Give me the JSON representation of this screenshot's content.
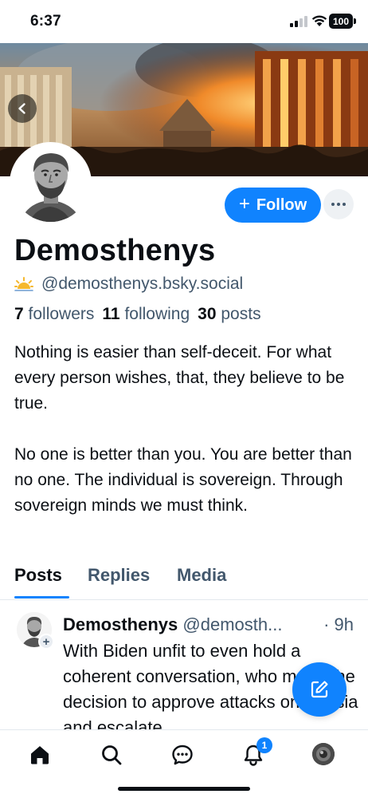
{
  "status_bar": {
    "time": "6:37",
    "battery": "100"
  },
  "banner": {
    "description_icon": "burning-city-painting"
  },
  "profile": {
    "display_name": "Demosthenys",
    "handle": "@demosthenys.bsky.social",
    "stats": [
      {
        "value": "7",
        "label": "followers"
      },
      {
        "value": "11",
        "label": "following"
      },
      {
        "value": "30",
        "label": "posts"
      }
    ],
    "bio": [
      "Nothing is easier than self-deceit. For what every person wishes, that, they believe to be true.",
      "No one is better than you. You are better than no one. The individual is sovereign. Through sovereign minds we must think."
    ]
  },
  "actions": {
    "follow_plus": "+",
    "follow_label": "Follow"
  },
  "tabs": [
    {
      "label": "Posts",
      "active": true
    },
    {
      "label": "Replies",
      "active": false
    },
    {
      "label": "Media",
      "active": false
    }
  ],
  "post": {
    "author": "Demosthenys",
    "handle": "@demosth...",
    "time": "· 9h",
    "text": "With Biden unfit to even hold a coherent conversation, who made the decision to approve attacks on Russia and escalate"
  },
  "bottom_nav": {
    "items": [
      "home-icon",
      "search-icon",
      "chat-icon",
      "bell-icon",
      "profile-avatar"
    ],
    "notification_count": "1"
  },
  "colors": {
    "accent": "#1083fe",
    "muted_text": "#42576c",
    "text": "#0b0f14"
  }
}
